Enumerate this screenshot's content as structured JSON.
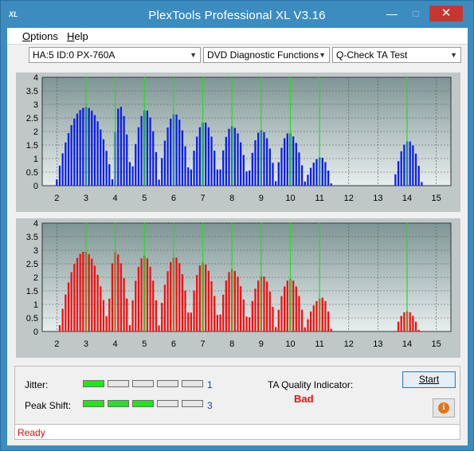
{
  "window": {
    "title": "PlexTools Professional XL V3.16",
    "app_icon": "XL"
  },
  "menu": [
    {
      "label": "Options",
      "accel": "O",
      "rest": "ptions"
    },
    {
      "label": "Help",
      "accel": "H",
      "rest": "elp"
    }
  ],
  "toolbar": {
    "drive": "HA:5 ID:0  PX-760A",
    "function": "DVD Diagnostic Functions",
    "test": "Q-Check TA Test"
  },
  "colors": {
    "top_bars": "#0a1ee6",
    "bottom_bars": "#ee1111",
    "markers": "#22dd22",
    "plot_bg_top": "#7f9595",
    "plot_bg_bottom": "#e8eeee"
  },
  "chart_data": [
    {
      "type": "bar",
      "series_color": "blue",
      "xlim": [
        1.5,
        15.5
      ],
      "ylim": [
        0,
        4
      ],
      "x_ticks": [
        "2",
        "3",
        "4",
        "5",
        "6",
        "7",
        "8",
        "9",
        "10",
        "11",
        "12",
        "13",
        "14",
        "15"
      ],
      "y_ticks": [
        "0",
        "0.5",
        "1",
        "1.5",
        "2",
        "2.5",
        "3",
        "3.5",
        "4"
      ],
      "markers": [
        3,
        4,
        5,
        6,
        7,
        8,
        9,
        10,
        11,
        14
      ],
      "peaks": [
        {
          "x0": 2.0,
          "x1": 3.9,
          "c": 3.0,
          "h": 2.9
        },
        {
          "x0": 3.9,
          "x1": 4.55,
          "c": 4.15,
          "h": 2.95
        },
        {
          "x0": 4.55,
          "x1": 5.5,
          "c": 5.05,
          "h": 2.8
        },
        {
          "x0": 5.5,
          "x1": 6.55,
          "c": 6.05,
          "h": 2.65
        },
        {
          "x0": 6.55,
          "x1": 7.55,
          "c": 7.05,
          "h": 2.35
        },
        {
          "x0": 7.55,
          "x1": 8.55,
          "c": 8.0,
          "h": 2.2
        },
        {
          "x0": 8.55,
          "x1": 9.5,
          "c": 9.0,
          "h": 2.05
        },
        {
          "x0": 9.5,
          "x1": 10.5,
          "c": 9.95,
          "h": 1.95
        },
        {
          "x0": 10.5,
          "x1": 11.4,
          "c": 11.05,
          "h": 1.05
        },
        {
          "x0": 13.55,
          "x1": 14.5,
          "c": 14.05,
          "h": 1.65
        }
      ]
    },
    {
      "type": "bar",
      "series_color": "red",
      "xlim": [
        1.5,
        15.5
      ],
      "ylim": [
        0,
        4
      ],
      "x_ticks": [
        "2",
        "3",
        "4",
        "5",
        "6",
        "7",
        "8",
        "9",
        "10",
        "11",
        "12",
        "13",
        "14",
        "15"
      ],
      "y_ticks": [
        "0",
        "0.5",
        "1",
        "1.5",
        "2",
        "2.5",
        "3",
        "3.5",
        "4"
      ],
      "markers": [
        3,
        4,
        5,
        6,
        7,
        8,
        9,
        10,
        11,
        14
      ],
      "peaks": [
        {
          "x0": 2.1,
          "x1": 3.75,
          "c": 2.95,
          "h": 2.95
        },
        {
          "x0": 3.75,
          "x1": 4.5,
          "c": 4.0,
          "h": 2.95
        },
        {
          "x0": 4.5,
          "x1": 5.5,
          "c": 5.0,
          "h": 2.8
        },
        {
          "x0": 5.5,
          "x1": 6.55,
          "c": 6.05,
          "h": 2.75
        },
        {
          "x0": 6.55,
          "x1": 7.55,
          "c": 7.0,
          "h": 2.55
        },
        {
          "x0": 7.55,
          "x1": 8.55,
          "c": 8.0,
          "h": 2.3
        },
        {
          "x0": 8.55,
          "x1": 9.5,
          "c": 9.05,
          "h": 2.05
        },
        {
          "x0": 9.5,
          "x1": 10.5,
          "c": 10.0,
          "h": 1.95
        },
        {
          "x0": 10.5,
          "x1": 11.4,
          "c": 11.1,
          "h": 1.25
        },
        {
          "x0": 13.6,
          "x1": 14.4,
          "c": 14.0,
          "h": 0.75
        }
      ]
    }
  ],
  "indicators": {
    "jitter_label": "Jitter:",
    "jitter_value": "1",
    "jitter_level": 1,
    "peak_shift_label": "Peak Shift:",
    "peak_shift_value": "3",
    "peak_shift_level": 3,
    "segments_total": 5,
    "ta_quality_label": "TA Quality Indicator:",
    "ta_quality_value": "Bad"
  },
  "buttons": {
    "start": "Start",
    "info_icon": "info-icon"
  },
  "status": {
    "text": "Ready"
  }
}
